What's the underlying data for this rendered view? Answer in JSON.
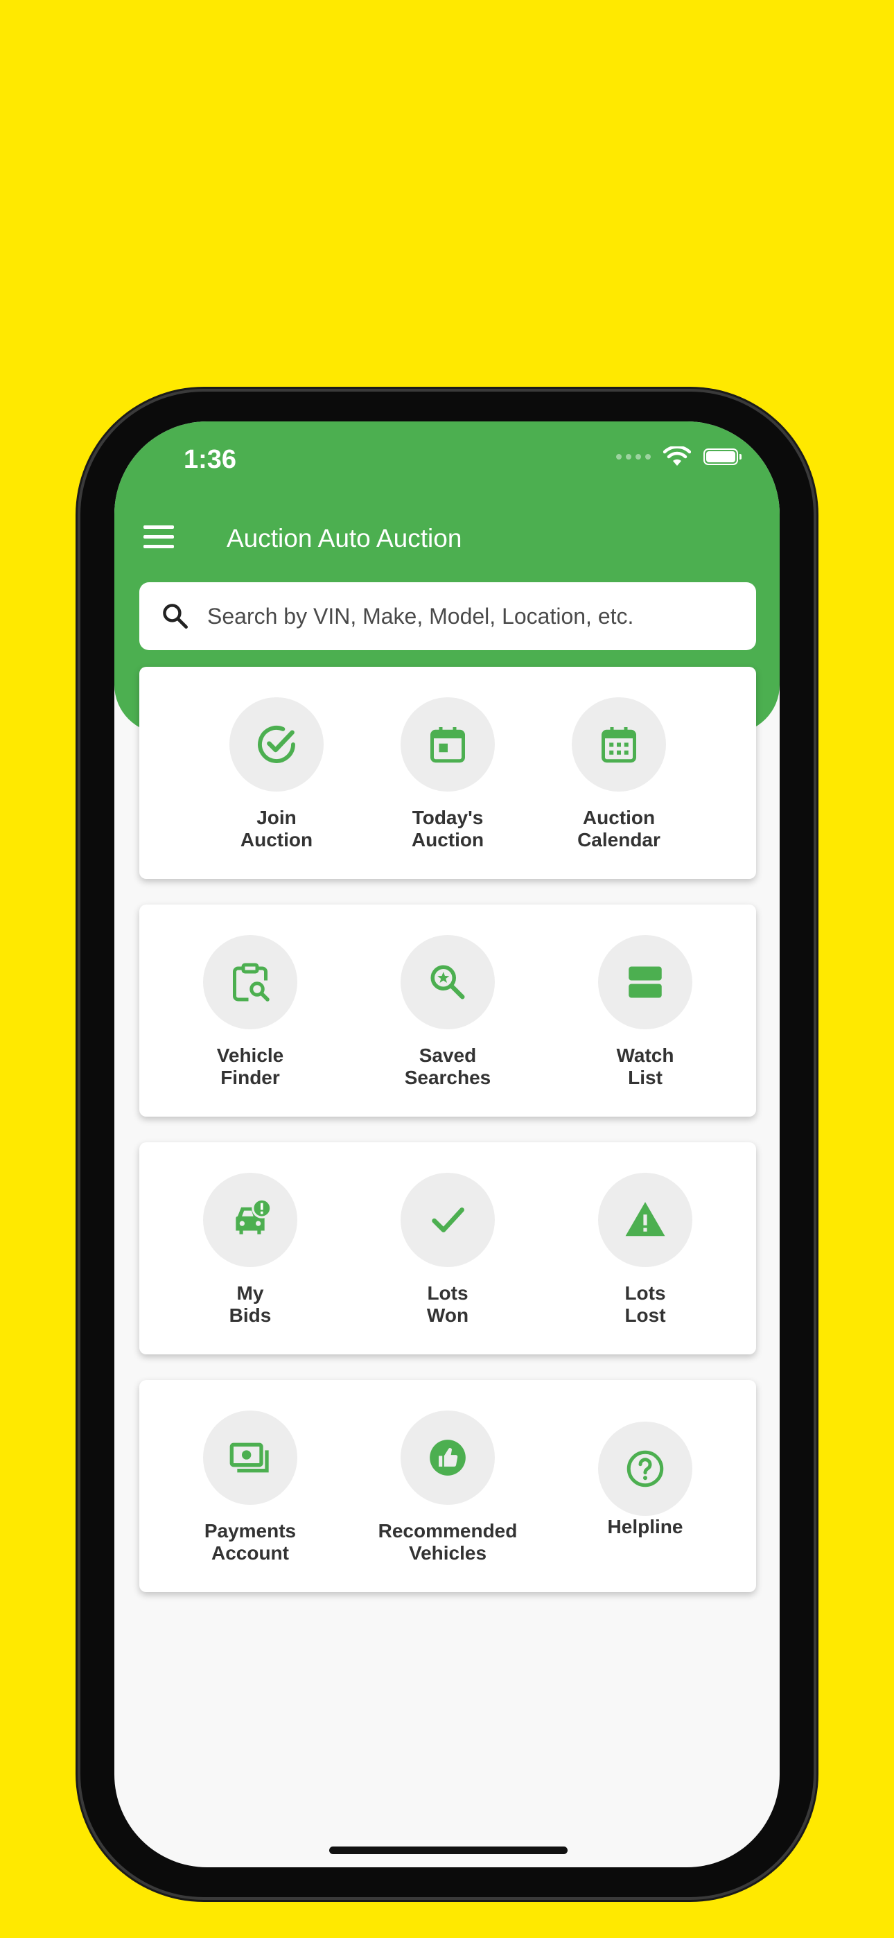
{
  "status_bar": {
    "time": "1:36"
  },
  "header": {
    "title": "Auction Auto Auction",
    "search_placeholder": "Search by VIN, Make, Model, Location, etc."
  },
  "tiles": {
    "join_auction": "Join\nAuction",
    "todays_auction": "Today's\nAuction",
    "auction_calendar": "Auction\nCalendar",
    "vehicle_finder": "Vehicle\nFinder",
    "saved_searches": "Saved\nSearches",
    "watch_list": "Watch\nList",
    "my_bids": "My\nBids",
    "lots_won": "Lots\nWon",
    "lots_lost": "Lots\nLost",
    "payments_account": "Payments\nAccount",
    "recommended_vehicles": "Recommended\nVehicles",
    "helpline": "Helpline"
  },
  "colors": {
    "accent": "#4CAF50",
    "background": "#FFE900",
    "tile_circle": "#EDEDED"
  }
}
